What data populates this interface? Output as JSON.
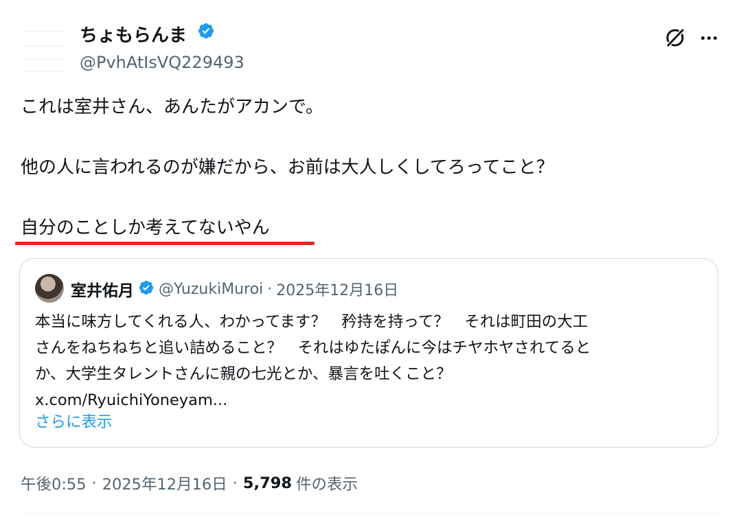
{
  "post": {
    "display_name": "ちょもらんま",
    "handle": "@PvhAtIsVQ229493",
    "lines": [
      "これは室井さん、あんたがアカンで。",
      "他の人に言われるのが嫌だから、お前は大人しくしてろってこと？",
      "自分のことしか考えてないやん"
    ]
  },
  "quote": {
    "display_name": "室井佑月",
    "handle": "@YuzukiMuroi",
    "separator": "·",
    "date": "2025年12月16日",
    "lines": [
      "本当に味方してくれる人、わかってます？　矜持を持って？　それは町田の大工",
      "さんをねちねちと追い詰めること？　それはゆたぽんに今はチヤホヤされてると",
      "か、大学生タレントさんに親の七光とか、暴言を吐くこと？"
    ],
    "link": "x.com/RyuichiYoneyam...",
    "show_more": "さらに表示"
  },
  "meta": {
    "time": "午後0:55",
    "separator": "·",
    "date": "2025年12月16日",
    "views_count": "5,798",
    "views_label": "件の表示"
  },
  "colors": {
    "verified": "#1d9bf0",
    "link_blue": "#1d9bf0",
    "secondary_text": "#536471",
    "annotation_red": "#e52420"
  },
  "icons": [
    "verified-badge-icon",
    "grok-icon",
    "more-options-icon"
  ]
}
